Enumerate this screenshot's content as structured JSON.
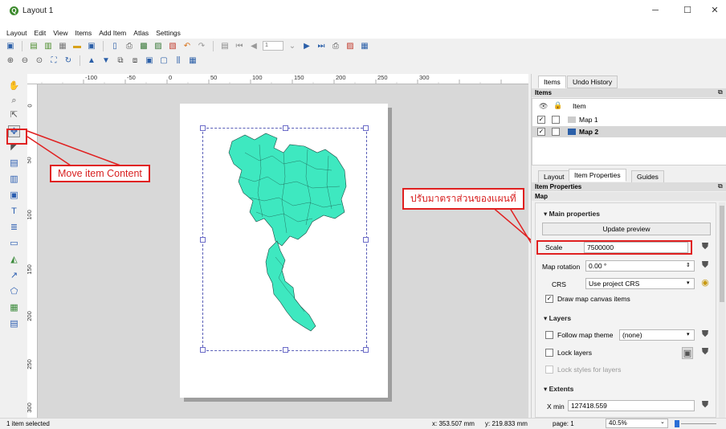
{
  "window": {
    "title": "Layout 1",
    "minimize": "─",
    "maximize": "☐",
    "close": "✕"
  },
  "menu": [
    "Layout",
    "Edit",
    "View",
    "Items",
    "Add Item",
    "Atlas",
    "Settings"
  ],
  "toolbar": {
    "page_value": "1"
  },
  "ruler": {
    "h_labels": [
      "-100",
      "-50",
      "0",
      "50",
      "100",
      "150",
      "200",
      "250",
      "300"
    ],
    "v_labels": [
      "0",
      "50",
      "100",
      "150",
      "200",
      "250",
      "300"
    ]
  },
  "callouts": {
    "move_item_content": "Move item Content",
    "scale_note": "ปรับมาตราส่วนของแผนที่"
  },
  "panel": {
    "top_tabs": [
      "Items",
      "Undo History"
    ],
    "items_header": "Items",
    "items_col_title": "Item",
    "items": [
      {
        "name": "Map 1",
        "visible": true,
        "locked": false,
        "selected": false
      },
      {
        "name": "Map 2",
        "visible": true,
        "locked": false,
        "selected": true
      }
    ],
    "bottom_tabs": [
      "Layout",
      "Item Properties",
      "Guides"
    ],
    "props_header": "Item Properties",
    "props_sub": "Map",
    "main_properties": "Main properties",
    "update_preview": "Update preview",
    "scale_label": "Scale",
    "scale_value": "7500000",
    "rotation_label": "Map rotation",
    "rotation_value": "0.00 °",
    "crs_label": "CRS",
    "crs_value": "Use project CRS",
    "draw_items_label": "Draw map canvas items",
    "layers_head": "Layers",
    "follow_theme_label": "Follow map theme",
    "follow_theme_value": "(none)",
    "lock_layers_label": "Lock layers",
    "lock_styles_label": "Lock styles for layers",
    "extents_head": "Extents",
    "xmin_label": "X min",
    "xmin_value": "127418.559"
  },
  "status": {
    "left": "1 item selected",
    "x": "x: 353.507 mm",
    "y": "y: 219.833 mm",
    "page": "page: 1",
    "zoom": "40.5%"
  },
  "colors": {
    "map_fill": "#3ee8c0",
    "callout_red": "#e02020",
    "frame": "#5a5fb8"
  }
}
